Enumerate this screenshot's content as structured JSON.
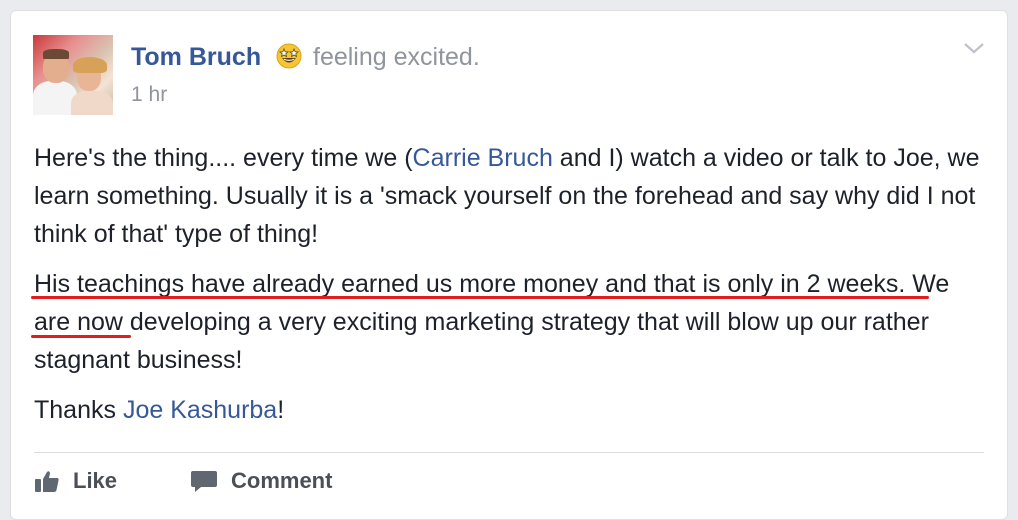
{
  "post": {
    "author": "Tom Bruch",
    "feeling": "feeling excited.",
    "feeling_emoji": "star-struck-emoji",
    "time": "1 hr",
    "paragraph1": {
      "before": "Here's the thing.... every time we (",
      "mention": "Carrie Bruch",
      "after": " and I) watch a video or talk to Joe, we learn something. Usually it is a 'smack yourself on the forehead and say why did I not think of that' type of thing!"
    },
    "paragraph2": "His teachings have already earned us more money and that is only in 2 weeks. We are now developing a very exciting marketing strategy that will blow up our rather stagnant business!",
    "paragraph3": {
      "before": "Thanks ",
      "mention": "Joe Kashurba",
      "after": "!"
    }
  },
  "actions": {
    "like_label": "Like",
    "comment_label": "Comment"
  },
  "colors": {
    "link": "#365899",
    "annotation_underline": "#e31c1c",
    "secondary_text": "#90949c"
  }
}
